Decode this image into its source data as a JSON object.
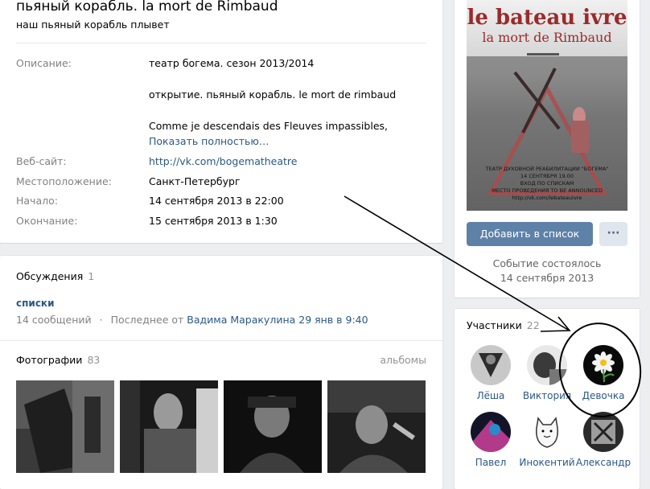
{
  "event": {
    "title": "пьяный корабль. la mort de Rimbaud",
    "subtitle": "наш пьяный корабль плывет",
    "info": {
      "description_label": "Описание:",
      "description_lines": [
        "театр богема. сезон 2013/2014",
        "открытие. пьяный корабль. le mort de rimbaud",
        "Comme je descendais des Fleuves impassibles,"
      ],
      "show_more": "Показать полностью…",
      "website_label": "Веб-сайт:",
      "website_value": "http://vk.com/bogematheatre",
      "location_label": "Местоположение:",
      "location_value": "Санкт-Петербург",
      "start_label": "Начало:",
      "start_value": "14 сентября 2013 в 22:00",
      "end_label": "Окончание:",
      "end_value": "15 сентября 2013 в 1:30"
    }
  },
  "discussions": {
    "title": "Обсуждения",
    "count": "1",
    "topic_title": "списки",
    "messages": "14 сообщений",
    "separator": "·",
    "last_prefix": "Последнее от",
    "last_author": "Вадима Маракулина",
    "last_date": "29 янв в 9:40"
  },
  "photos": {
    "title": "Фотографии",
    "count": "83",
    "albums_link": "альбомы"
  },
  "poster": {
    "title_line1": "le bateau ivre",
    "title_line2": "la mort de Rimbaud",
    "caption_lines": [
      "ТЕАТР ДУХОВНОЙ РЕАБИЛИТАЦИИ \"БОГЕМА\"",
      "14 СЕНТЯБРЯ 19.00",
      "ВХОД ПО СПИСКАМ",
      "МЕСТО ПРОВЕДЕНИЯ TO BE ANNOUNCED",
      "http://vk.com/lebateauivre"
    ]
  },
  "sidebar": {
    "add_button": "Добавить в список",
    "more_button": "···",
    "status_line1": "Событие состоялось",
    "status_line2": "14 сентября 2013"
  },
  "members": {
    "title": "Участники",
    "count": "22",
    "people": [
      {
        "name": "Лёша"
      },
      {
        "name": "Виктория"
      },
      {
        "name": "Девочка"
      },
      {
        "name": "Павел"
      },
      {
        "name": "Инокентий"
      },
      {
        "name": "Александр"
      }
    ]
  },
  "colors": {
    "link": "#2a5885",
    "button": "#5e81a8",
    "annotation": "#000000"
  }
}
